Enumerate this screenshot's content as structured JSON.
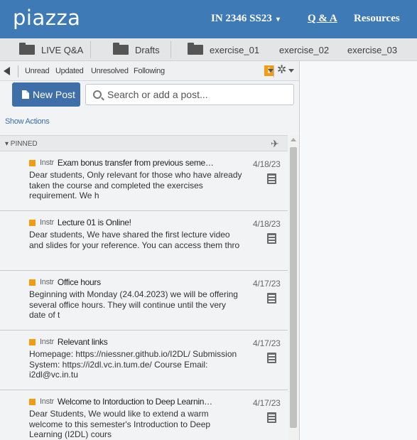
{
  "topbar": {
    "logo": "piazza",
    "course": "IN 2346 SS23",
    "course_caret": "▾",
    "nav": {
      "qa": "Q & A",
      "resources": "Resources"
    }
  },
  "folders": [
    {
      "label": "LIVE Q&A",
      "icon": "folder-icon"
    },
    {
      "label": "Drafts",
      "icon": "folder-icon"
    },
    {
      "label": "exercise_01",
      "icon": "folder-icon"
    },
    {
      "label": "exercise_02"
    },
    {
      "label": "exercise_03"
    }
  ],
  "filters": {
    "unread": "Unread",
    "updated": "Updated",
    "unresolved": "Unresolved",
    "following": "Following"
  },
  "toolbar": {
    "info": "i",
    "gear": "✲"
  },
  "new_post": "New Post",
  "search": {
    "placeholder": "Search or add a post..."
  },
  "show_actions": "Show Actions",
  "pinned_label": "▾ PINNED",
  "pin_icon": "✈",
  "posts": [
    {
      "tag": "Instr",
      "title": "Exam bonus transfer from previous seme…",
      "date": "4/18/23",
      "body": "Dear students, Only relevant for those who have already taken the course and completed the exercises requirement. We h"
    },
    {
      "tag": "Instr",
      "title": "Lecture 01 is Online!",
      "date": "4/18/23",
      "body": "Dear students, We have shared the first lecture video and slides for your reference. You can access them thro"
    },
    {
      "tag": "Instr",
      "title": "Office hours",
      "date": "4/17/23",
      "body": "Beginning with Monday (24.04.2023) we will be offering several office hours. They will continue until the very date of t"
    },
    {
      "tag": "Instr",
      "title": "Relevant links",
      "date": "4/17/23",
      "body": "Homepage: https://niessner.github.io/I2DL/ Submission System: https://i2dl.vc.in.tum.de/ Course Email: i2dl@vc.in.tu"
    },
    {
      "tag": "Instr",
      "title": "Welcome to Intorduction to Deep Learnin…",
      "date": "4/17/23",
      "body": "Dear Students, We would like to extend a warm welcome to this semester's Introduction to Deep Learning (I2DL) cours"
    }
  ],
  "colors": {
    "topbar": "#3e7ab5",
    "accent_button": "#3e6fa8",
    "instr_tag": "#f39c12"
  }
}
